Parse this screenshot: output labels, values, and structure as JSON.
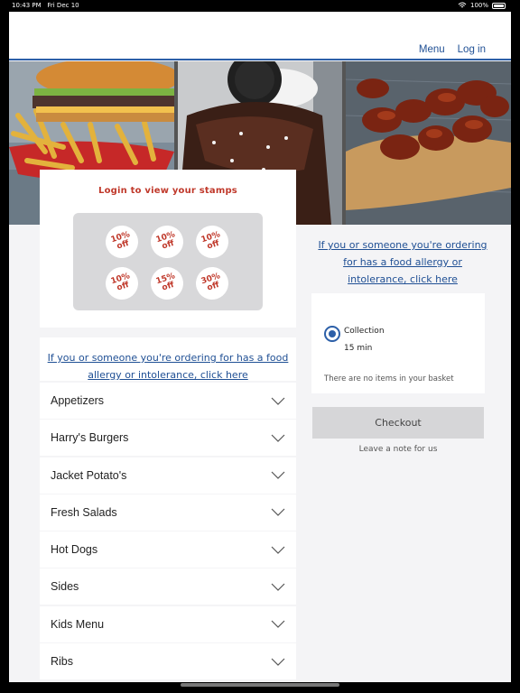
{
  "status": {
    "time": "10:43 PM",
    "date": "Fri Dec 10",
    "battery": "100%"
  },
  "nav": {
    "menu": "Menu",
    "login": "Log in"
  },
  "stamps": {
    "title": "Login to view your stamps",
    "items": [
      {
        "pct": "10%",
        "word": "off"
      },
      {
        "pct": "10%",
        "word": "off"
      },
      {
        "pct": "10%",
        "word": "off"
      },
      {
        "pct": "10%",
        "word": "off"
      },
      {
        "pct": "15%",
        "word": "off"
      },
      {
        "pct": "30%",
        "word": "off"
      }
    ]
  },
  "allergy_right": "If you or someone you're ordering for has a food allergy or intolerance, click here",
  "allergy_left": "If you or someone you're ordering for has a food allergy or intolerance, click here",
  "basket": {
    "collection_label": "Collection",
    "collection_time": "15 min",
    "empty": "There are no items in your basket"
  },
  "checkout": "Checkout",
  "note": "Leave a note for us",
  "menu": [
    {
      "label": "Appetizers"
    },
    {
      "label": "Harry's Burgers"
    },
    {
      "label": "Jacket Potato's"
    },
    {
      "label": "Fresh Salads"
    },
    {
      "label": "Hot Dogs"
    },
    {
      "label": "Sides"
    },
    {
      "label": "Kids Menu"
    },
    {
      "label": "Ribs"
    }
  ],
  "colors": {
    "accent": "#1f4f94",
    "stamp_red": "#c0392b"
  }
}
